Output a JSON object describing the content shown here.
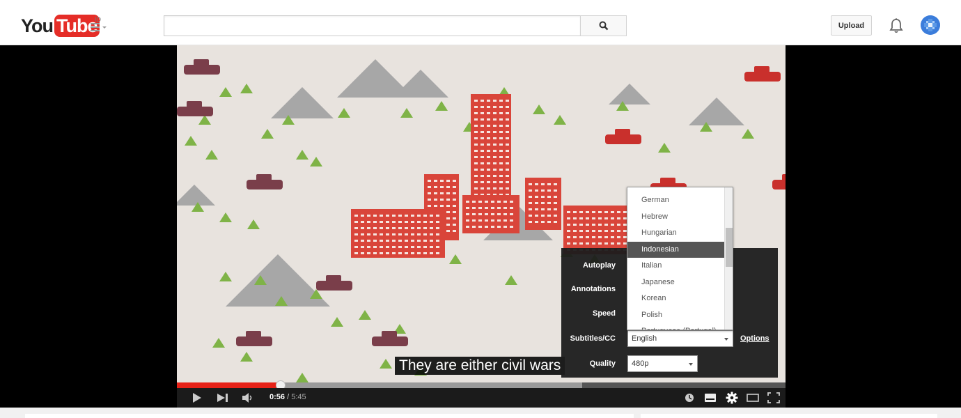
{
  "masthead": {
    "logo_you": "You",
    "logo_tube": "Tube",
    "logo_country": "ID",
    "search_placeholder": "",
    "upload_label": "Upload"
  },
  "video": {
    "caption": "They are either civil wars",
    "current_time": "0:56",
    "time_separator": "/",
    "duration": "5:45",
    "progress_fraction": 0.171,
    "buffer_fraction": 0.666
  },
  "settings": {
    "autoplay_label": "Autoplay",
    "annotations_label": "Annotations",
    "speed_label": "Speed",
    "subtitles_label": "Subtitles/CC",
    "subtitles_value": "English",
    "options_label": "Options",
    "quality_label": "Quality",
    "quality_value": "480p"
  },
  "subtitle_dropdown": {
    "items": [
      "German",
      "Hebrew",
      "Hungarian",
      "Indonesian",
      "Italian",
      "Japanese",
      "Korean",
      "Polish",
      "Portuguese (Portugal)"
    ],
    "selected": "Indonesian"
  },
  "colors": {
    "brand_red": "#e52d27",
    "progress_red": "#e62117"
  }
}
